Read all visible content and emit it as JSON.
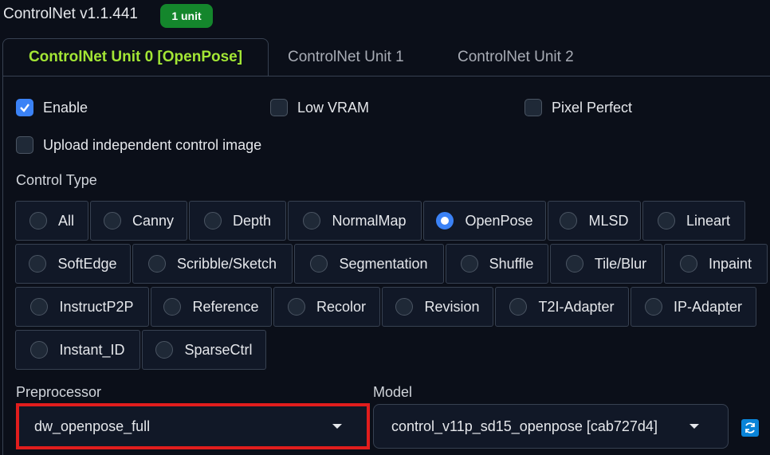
{
  "header": {
    "title": "ControlNet v1.1.441",
    "badge": "1 unit"
  },
  "tabs": [
    {
      "label": "ControlNet Unit 0 [OpenPose]",
      "active": true
    },
    {
      "label": "ControlNet Unit 1",
      "active": false
    },
    {
      "label": "ControlNet Unit 2",
      "active": false
    }
  ],
  "options": {
    "enable": {
      "label": "Enable",
      "checked": true
    },
    "low_vram": {
      "label": "Low VRAM",
      "checked": false
    },
    "pixel_perfect": {
      "label": "Pixel Perfect",
      "checked": false
    },
    "upload_independent": {
      "label": "Upload independent control image",
      "checked": false
    }
  },
  "control_type": {
    "label": "Control Type",
    "selected": "OpenPose",
    "items": [
      "All",
      "Canny",
      "Depth",
      "NormalMap",
      "OpenPose",
      "MLSD",
      "Lineart",
      "SoftEdge",
      "Scribble/Sketch",
      "Segmentation",
      "Shuffle",
      "Tile/Blur",
      "Inpaint",
      "InstructP2P",
      "Reference",
      "Recolor",
      "Revision",
      "T2I-Adapter",
      "IP-Adapter",
      "Instant_ID",
      "SparseCtrl"
    ]
  },
  "preprocessor": {
    "label": "Preprocessor",
    "value": "dw_openpose_full"
  },
  "model": {
    "label": "Model",
    "value": "control_v11p_sd15_openpose [cab727d4]"
  },
  "colors": {
    "accent": "#3b82f6",
    "active_tab": "#a3e635",
    "badge": "#14862c",
    "highlight": "#e11d1d"
  },
  "icons": {
    "refresh": "refresh-icon",
    "checkmark": "checkmark-icon",
    "caret": "chevron-down-icon"
  }
}
